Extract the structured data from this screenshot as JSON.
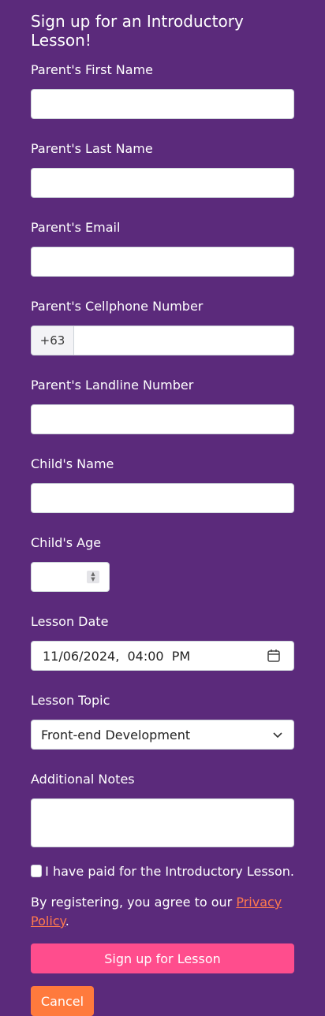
{
  "form": {
    "title": "Sign up for an Introductory Lesson!",
    "fields": {
      "first_name_label": "Parent's First Name",
      "last_name_label": "Parent's Last Name",
      "email_label": "Parent's Email",
      "cellphone_label": "Parent's Cellphone Number",
      "cellphone_prefix": "+63",
      "landline_label": "Parent's Landline Number",
      "child_name_label": "Child's Name",
      "child_age_label": "Child's Age",
      "lesson_date_label": "Lesson Date",
      "lesson_date": {
        "month": "11",
        "day": "06",
        "year": "2024",
        "hour": "04",
        "minute": "00",
        "ampm": "PM"
      },
      "lesson_topic_label": "Lesson Topic",
      "lesson_topic_value": "Front-end Development",
      "notes_label": "Additional Notes"
    },
    "checkbox_label": "I have paid for the Introductory Lesson.",
    "terms_text": "By registering, you agree to our ",
    "privacy_link": "Privacy Policy",
    "terms_end": ".",
    "signup_button": "Sign up for Lesson",
    "cancel_button": "Cancel"
  },
  "colors": {
    "background": "#5b2a7b",
    "primary_button": "#ff4d8d",
    "cancel_button": "#ff7a3d",
    "link": "#ff7a4d"
  },
  "icons": {
    "calendar": "calendar-icon",
    "chevron": "chevron-down-icon",
    "spinner": "number-spinner-icon"
  }
}
